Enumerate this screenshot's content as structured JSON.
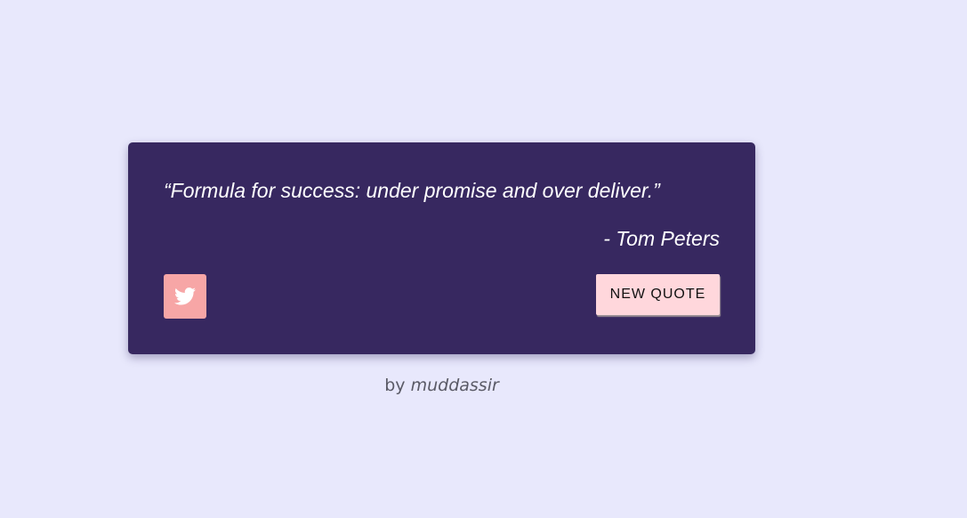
{
  "quote": {
    "text": "“Formula for success: under promise and over deliver.”",
    "author": "- Tom Peters"
  },
  "buttons": {
    "tweet_icon": "twitter-bird-icon",
    "new_quote_label": "NEW QUOTE"
  },
  "footer": {
    "prefix": "by",
    "author": "muddassir"
  },
  "colors": {
    "background": "#e8e8fc",
    "card": "#372860",
    "tweet_button": "#f7a6a6",
    "new_quote_button": "#ffd7dc"
  }
}
